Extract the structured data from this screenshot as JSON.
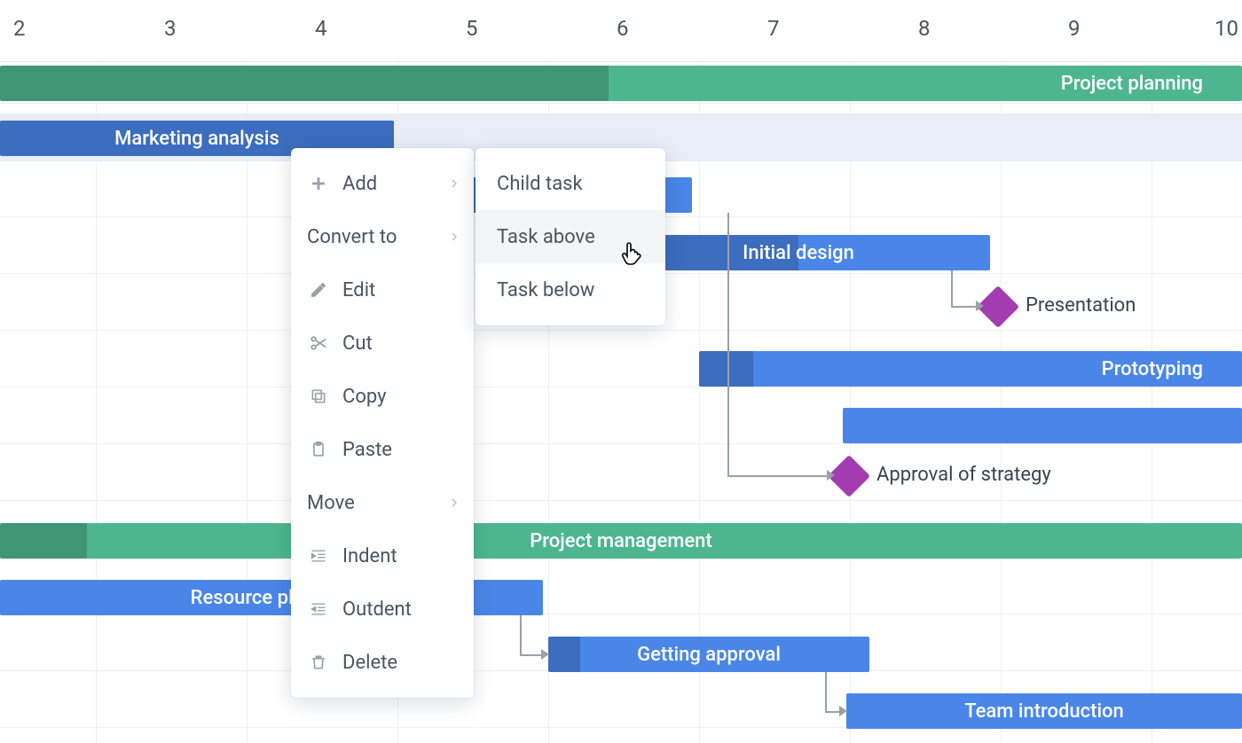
{
  "timeline": {
    "ticks": [
      2,
      3,
      4,
      5,
      6,
      7,
      8,
      9,
      10
    ]
  },
  "groups": {
    "project_planning": {
      "label": "Project planning"
    },
    "project_management": {
      "label": "Project management"
    }
  },
  "tasks": {
    "marketing_analysis": {
      "label": "Marketing analysis"
    },
    "initial_design": {
      "label": "Initial design"
    },
    "prototyping": {
      "label": "Prototyping"
    },
    "resource_planning": {
      "label": "Resource planning"
    },
    "getting_approval": {
      "label": "Getting approval"
    },
    "team_introduction": {
      "label": "Team introduction"
    }
  },
  "milestones": {
    "presentation": {
      "label": "Presentation"
    },
    "approval_of_strategy": {
      "label": "Approval of strategy"
    }
  },
  "context_menu": {
    "add": "Add",
    "convert_to": "Convert to",
    "edit": "Edit",
    "cut": "Cut",
    "copy": "Copy",
    "paste": "Paste",
    "move": "Move",
    "indent": "Indent",
    "outdent": "Outdent",
    "delete": "Delete"
  },
  "submenu": {
    "child_task": "Child task",
    "task_above": "Task above",
    "task_below": "Task below"
  },
  "colors": {
    "group": "#4db690",
    "task": "#4a86e8",
    "milestone": "#a23cb0",
    "highlight": "#e8edf8"
  },
  "chart_data": {
    "type": "gantt",
    "x_unit": "day",
    "x_range": [
      2,
      10
    ],
    "groups": [
      {
        "id": "project_planning",
        "label": "Project planning",
        "start": 1.5,
        "end": 10.5,
        "progress": 0.5
      },
      {
        "id": "project_management",
        "label": "Project management",
        "start": 1.5,
        "end": 10.5,
        "progress": 0.06
      }
    ],
    "tasks": [
      {
        "id": "marketing_analysis",
        "group": "project_planning",
        "label": "Marketing analysis",
        "start": 1.5,
        "end": 4.1,
        "progress": 1.0
      },
      {
        "id": "database_design",
        "group": "project_planning",
        "label": "",
        "start": 4.0,
        "end": 6.0,
        "progress": 0.5
      },
      {
        "id": "initial_design",
        "group": "project_planning",
        "label": "Initial design",
        "start": 5.5,
        "end": 8.0,
        "progress": 0.5
      },
      {
        "id": "prototyping",
        "group": "project_planning",
        "label": "Prototyping",
        "start": 6.1,
        "end": 10.5,
        "progress": 0.1
      },
      {
        "id": "analysis",
        "group": "project_planning",
        "label": "",
        "start": 7.0,
        "end": 10.5,
        "progress": 0.0
      },
      {
        "id": "resource_planning",
        "group": "project_management",
        "label": "Resource planning",
        "start": 1.5,
        "end": 5.0,
        "progress": 0.0
      },
      {
        "id": "getting_approval",
        "group": "project_management",
        "label": "Getting approval",
        "start": 5.0,
        "end": 7.5,
        "progress": 0.1
      },
      {
        "id": "team_introduction",
        "group": "project_management",
        "label": "Team introduction",
        "start": 7.0,
        "end": 10.0,
        "progress": 0.0
      }
    ],
    "milestones": [
      {
        "id": "presentation",
        "label": "Presentation",
        "at": 8.0
      },
      {
        "id": "approval_of_strategy",
        "label": "Approval of strategy",
        "at": 7.0
      }
    ],
    "dependencies": [
      [
        "marketing_analysis",
        "database_design"
      ],
      [
        "database_design",
        "initial_design"
      ],
      [
        "initial_design",
        "presentation"
      ],
      [
        "initial_design",
        "prototyping"
      ],
      [
        "database_design",
        "approval_of_strategy"
      ],
      [
        "resource_planning",
        "getting_approval"
      ],
      [
        "getting_approval",
        "team_introduction"
      ]
    ]
  }
}
